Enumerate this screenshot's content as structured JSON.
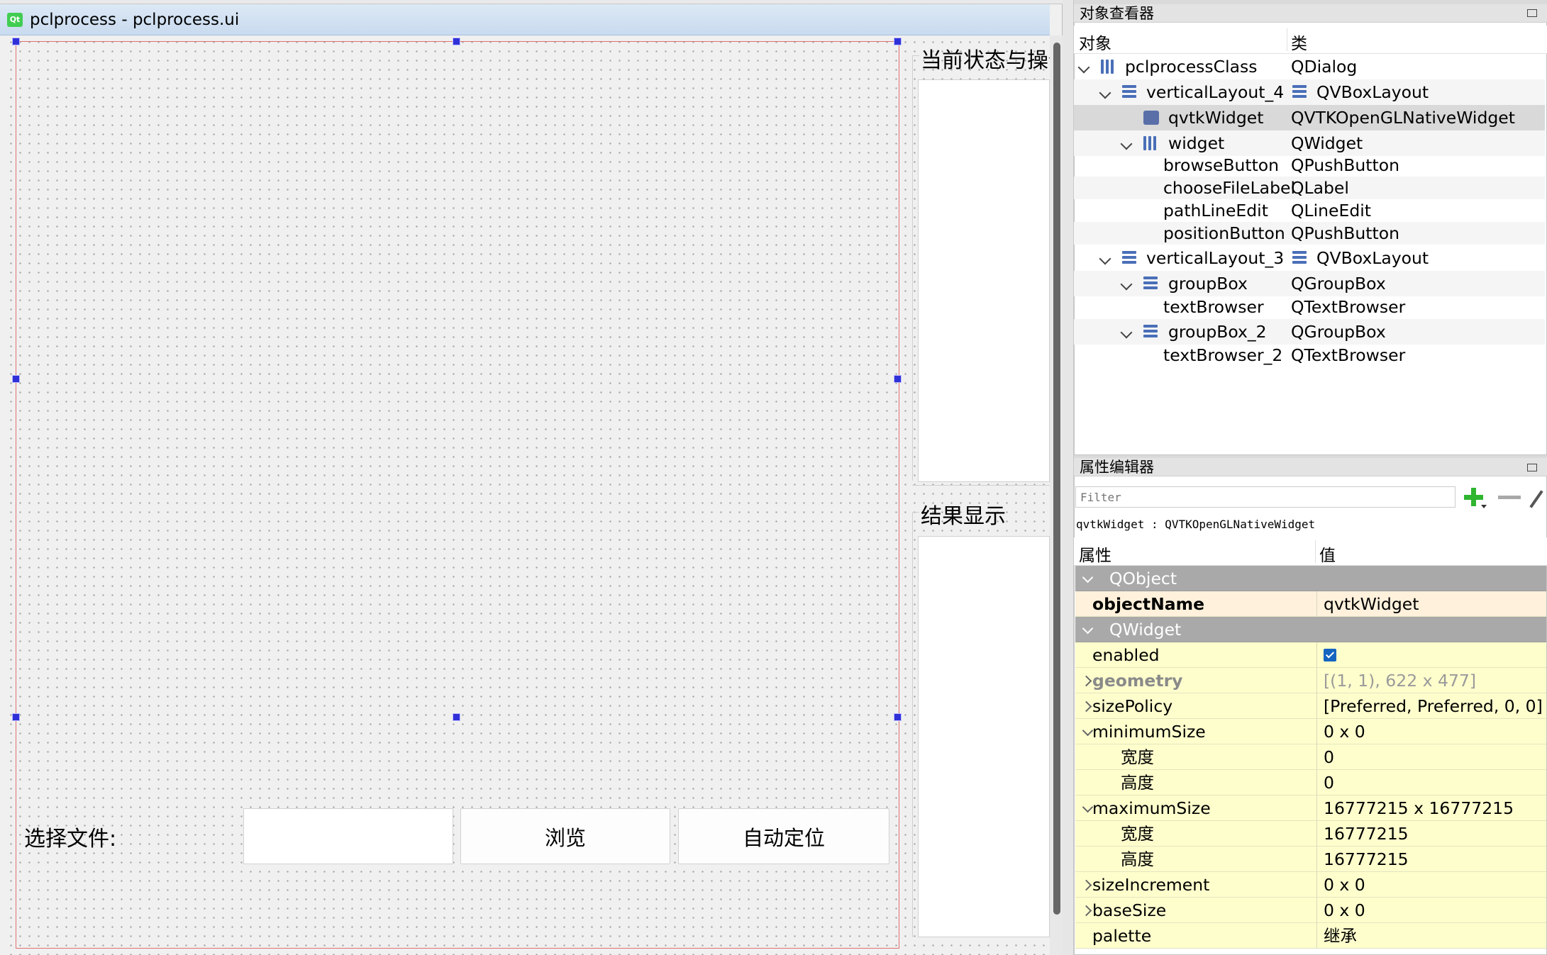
{
  "window": {
    "title": "pclprocess - pclprocess.ui",
    "logo": "Qt"
  },
  "form": {
    "groupbox_status_title": "当前状态与操作",
    "groupbox_result_title": "结果显示",
    "choose_file_label": "选择文件:",
    "path_value": "",
    "browse_button": "浏览",
    "position_button": "自动定位"
  },
  "object_inspector": {
    "title": "对象查看器",
    "col_object": "对象",
    "col_class": "类",
    "rows": [
      {
        "name": "pclprocessClass",
        "cls": "QDialog"
      },
      {
        "name": "verticalLayout_4",
        "cls": "QVBoxLayout"
      },
      {
        "name": "qvtkWidget",
        "cls": "QVTKOpenGLNativeWidget"
      },
      {
        "name": "widget",
        "cls": "QWidget"
      },
      {
        "name": "browseButton",
        "cls": "QPushButton"
      },
      {
        "name": "chooseFileLabel",
        "cls": "QLabel"
      },
      {
        "name": "pathLineEdit",
        "cls": "QLineEdit"
      },
      {
        "name": "positionButton",
        "cls": "QPushButton"
      },
      {
        "name": "verticalLayout_3",
        "cls": "QVBoxLayout"
      },
      {
        "name": "groupBox",
        "cls": "QGroupBox"
      },
      {
        "name": "textBrowser",
        "cls": "QTextBrowser"
      },
      {
        "name": "groupBox_2",
        "cls": "QGroupBox"
      },
      {
        "name": "textBrowser_2",
        "cls": "QTextBrowser"
      }
    ]
  },
  "property_editor": {
    "title": "属性编辑器",
    "filter_placeholder": "Filter",
    "context": "qvtkWidget : QVTKOpenGLNativeWidget",
    "col_property": "属性",
    "col_value": "值",
    "rows": [
      {
        "name": "QObject",
        "value": ""
      },
      {
        "name": "objectName",
        "value": "qvtkWidget"
      },
      {
        "name": "QWidget",
        "value": ""
      },
      {
        "name": "enabled",
        "value": ""
      },
      {
        "name": "geometry",
        "value": "[(1, 1), 622 x 477]"
      },
      {
        "name": "sizePolicy",
        "value": "[Preferred, Preferred, 0, 0]"
      },
      {
        "name": "minimumSize",
        "value": "0 x 0"
      },
      {
        "name": "宽度",
        "value": "0"
      },
      {
        "name": "高度",
        "value": "0"
      },
      {
        "name": "maximumSize",
        "value": "16777215 x 16777215"
      },
      {
        "name": "宽度",
        "value": "16777215"
      },
      {
        "name": "高度",
        "value": "16777215"
      },
      {
        "name": "sizeIncrement",
        "value": "0 x 0"
      },
      {
        "name": "baseSize",
        "value": "0 x 0"
      },
      {
        "name": "palette",
        "value": "继承"
      }
    ]
  }
}
